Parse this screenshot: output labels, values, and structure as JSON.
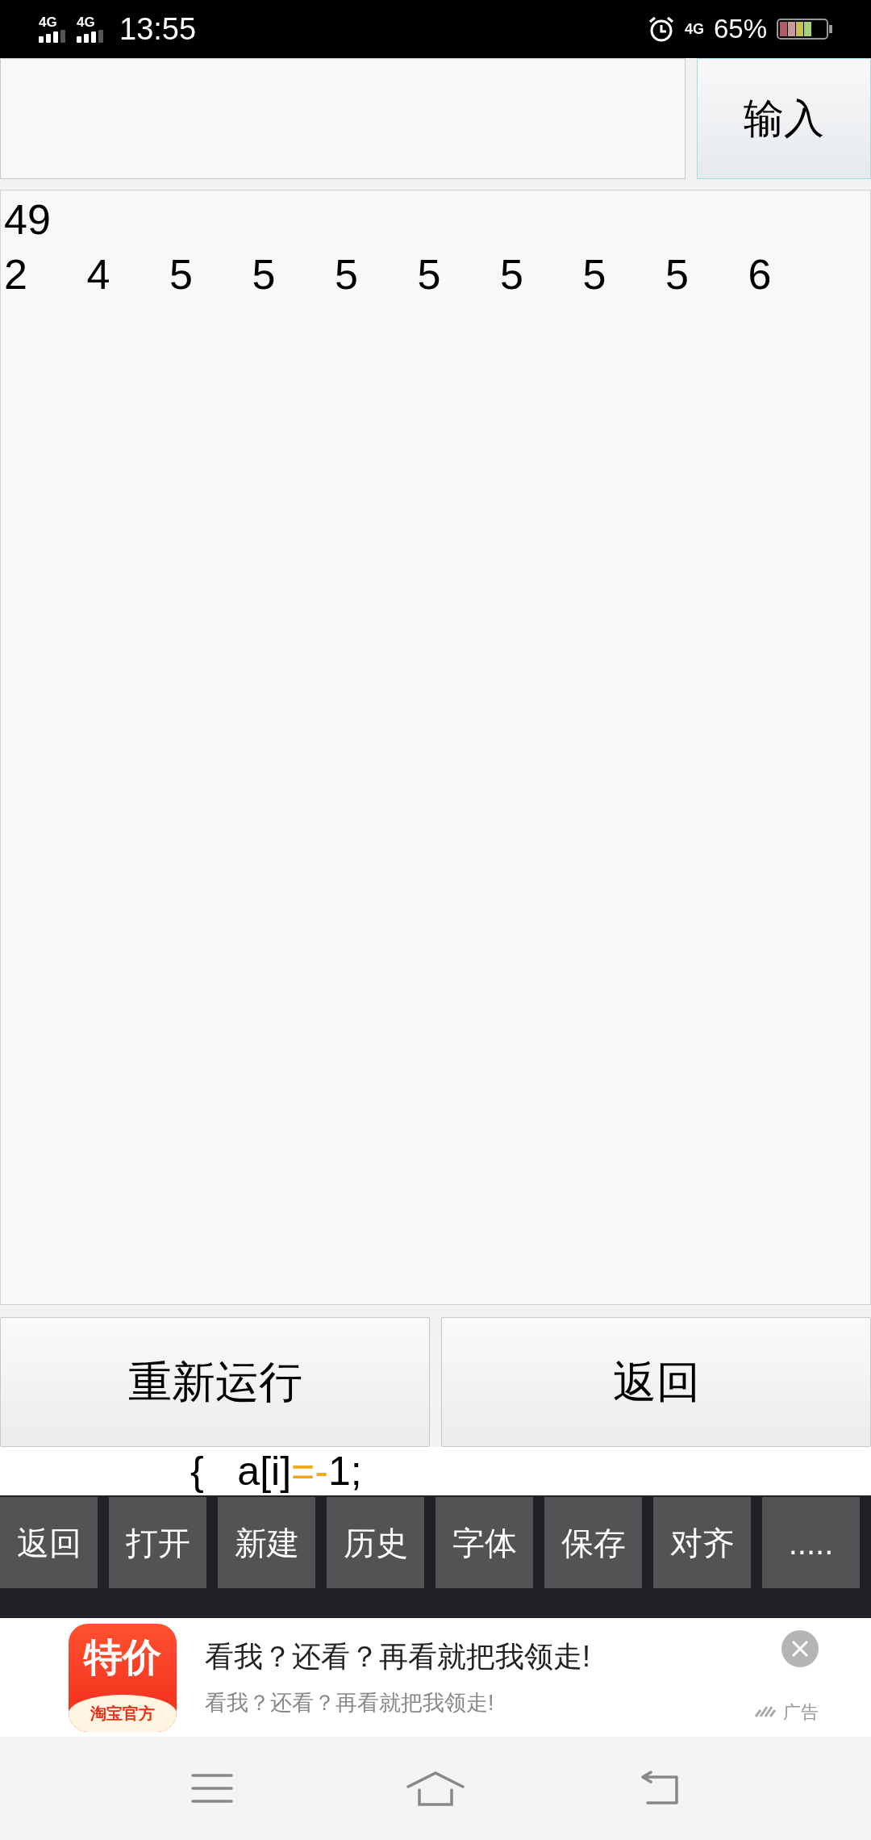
{
  "status_bar": {
    "networks": [
      "4G",
      "4G"
    ],
    "time": "13:55",
    "data_network": "4G",
    "battery_percent": "65%"
  },
  "input_row": {
    "button": "输入"
  },
  "output": {
    "lines": [
      [
        "49"
      ],
      [
        "2",
        "4",
        "5",
        "5",
        "5",
        "5",
        "5",
        "5",
        "5",
        "6"
      ]
    ]
  },
  "actions": [
    "重新运行",
    "返回"
  ],
  "code_line": [
    {
      "text": "{   a[i]",
      "kind": "plain"
    },
    {
      "text": "=-",
      "kind": "operator"
    },
    {
      "text": "1;",
      "kind": "plain"
    }
  ],
  "toolbar": [
    "返回",
    "打开",
    "新建",
    "历史",
    "字体",
    "保存",
    "对齐",
    "....."
  ],
  "ad": {
    "icon_text": "特价",
    "icon_subtext": "淘宝官方",
    "title": "看我？还看？再看就把我领走!",
    "subtitle": "看我？还看？再看就把我领走!",
    "label": "广告"
  }
}
